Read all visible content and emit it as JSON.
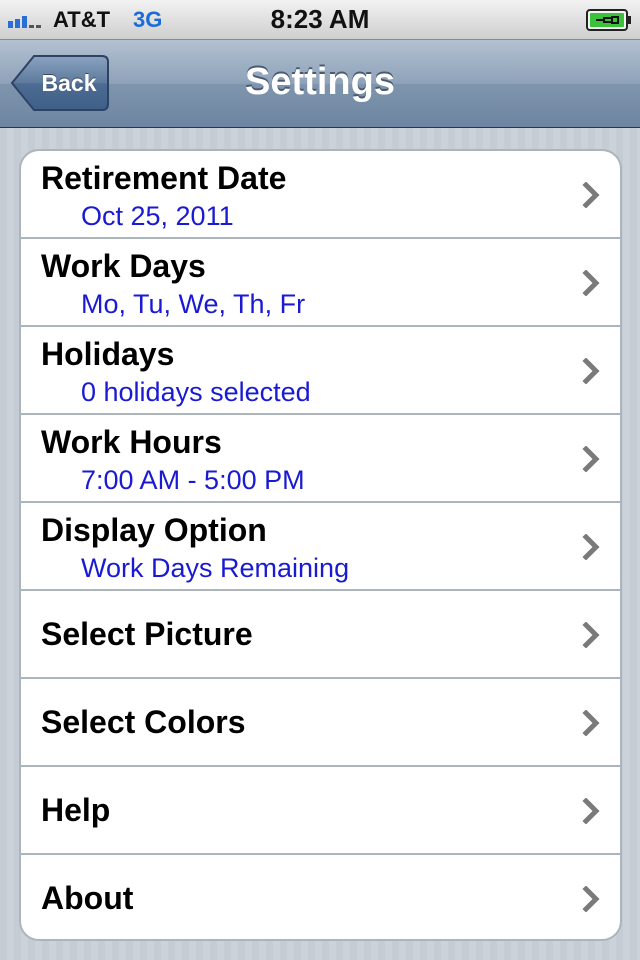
{
  "status_bar": {
    "carrier": "AT&T",
    "network": "3G",
    "time": "8:23 AM",
    "signal_icon": "signal-bars-icon",
    "battery_icon": "battery-charging-icon"
  },
  "nav_bar": {
    "back_label": "Back",
    "title": "Settings"
  },
  "settings": {
    "items": [
      {
        "title": "Retirement Date",
        "subtitle": "Oct 25, 2011"
      },
      {
        "title": "Work Days",
        "subtitle": "Mo, Tu, We, Th, Fr"
      },
      {
        "title": "Holidays",
        "subtitle": "0 holidays selected"
      },
      {
        "title": "Work Hours",
        "subtitle": "7:00 AM - 5:00 PM"
      },
      {
        "title": "Display Option",
        "subtitle": "Work Days Remaining"
      },
      {
        "title": "Select Picture"
      },
      {
        "title": "Select Colors"
      },
      {
        "title": "Help"
      },
      {
        "title": "About"
      }
    ]
  },
  "colors": {
    "subtitle_blue": "#1a1ad4",
    "nav_bar_blue": "#7f95ad",
    "network_blue": "#1a6dd8",
    "battery_green": "#39c23a"
  }
}
